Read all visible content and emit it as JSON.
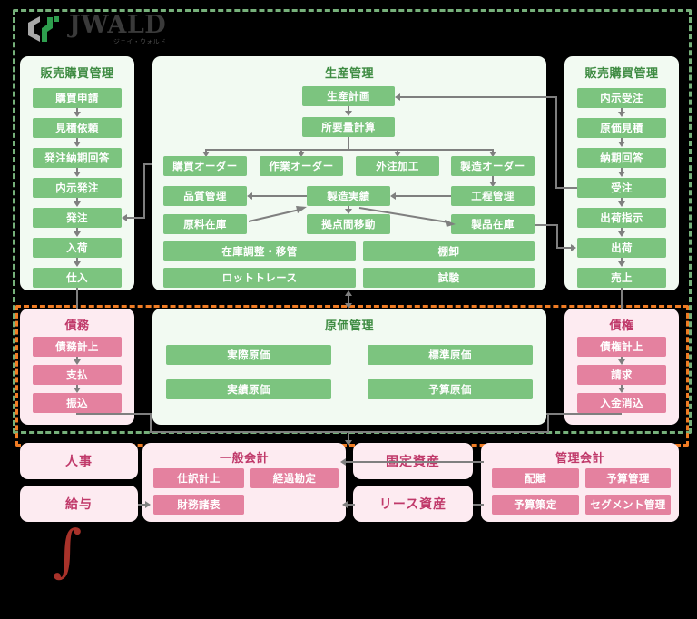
{
  "brand": {
    "logo_main": "JWALD",
    "logo_sub": "ジェイ・ウォルド",
    "mark_icon": "hexagon-logo-icon",
    "integral_symbol": "∫"
  },
  "colors": {
    "green_box": "#7cc47f",
    "green_panel": "#f2faf2",
    "green_title": "#3f8c43",
    "pink_box": "#e4819f",
    "pink_panel": "#fdebf1",
    "pink_title": "#c0396a",
    "scope_green": "#76b07a",
    "scope_orange": "#f07c24",
    "connector": "#7f7f7f"
  },
  "scopes": {
    "erp_scope_label": "production-scope-dashed-frame",
    "accounting_scope_label": "accounting-scope-dashed-frame"
  },
  "panels": {
    "purchasing": {
      "title": "販売購買管理",
      "items": [
        "購買申請",
        "見積依頼",
        "発注納期回答",
        "内示発注",
        "発注",
        "入荷",
        "仕入"
      ]
    },
    "production": {
      "title": "生産管理",
      "plan": "生産計画",
      "mrp": "所要量計算",
      "orders": [
        "購買オーダー",
        "作業オーダー",
        "外注加工",
        "製造オーダー"
      ],
      "row3": [
        "品質管理",
        "製造実績",
        "工程管理"
      ],
      "row4": [
        "原料在庫",
        "拠点間移動",
        "製品在庫"
      ],
      "wide": [
        "在庫調整・移管",
        "棚卸",
        "ロットトレース",
        "試験"
      ]
    },
    "sales": {
      "title": "販売購買管理",
      "items": [
        "内示受注",
        "原価見積",
        "納期回答",
        "受注",
        "出荷指示",
        "出荷",
        "売上"
      ]
    },
    "payable": {
      "title": "債務",
      "items": [
        "債務計上",
        "支払",
        "振込"
      ]
    },
    "costing": {
      "title": "原価管理",
      "items": [
        "実際原価",
        "標準原価",
        "実績原価",
        "予算原価"
      ]
    },
    "receivable": {
      "title": "債権",
      "items": [
        "債権計上",
        "請求",
        "入金消込"
      ]
    },
    "hr": {
      "label": "人事"
    },
    "payroll": {
      "label": "給与"
    },
    "general_accounting": {
      "title": "一般会計",
      "items": [
        "仕訳計上",
        "経過勘定",
        "財務諸表"
      ]
    },
    "fixed_assets": {
      "label": "固定資産"
    },
    "lease_assets": {
      "label": "リース資産"
    },
    "management_accounting": {
      "title": "管理会計",
      "items": [
        "配賦",
        "予算管理",
        "予算策定",
        "セグメント管理"
      ]
    }
  }
}
